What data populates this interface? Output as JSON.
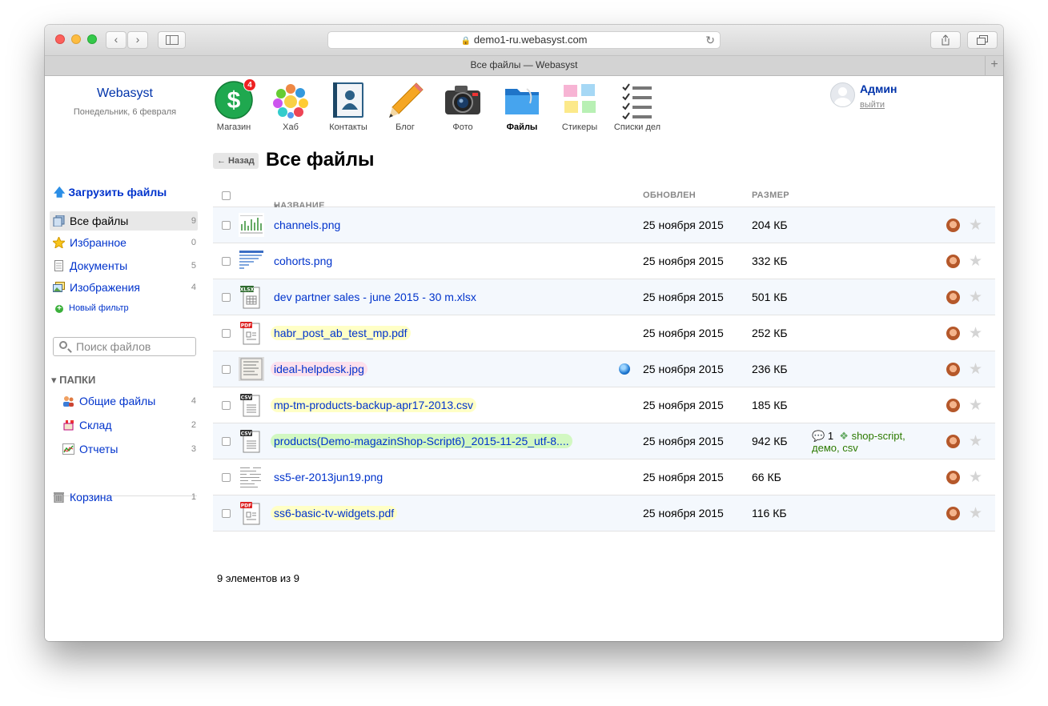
{
  "browser": {
    "url": "demo1-ru.webasyst.com",
    "tab_title": "Все файлы — Webasyst"
  },
  "sidebar": {
    "brand": "Webasyst",
    "date": "Понедельник, 6 февраля",
    "upload_label": "Загрузить файлы",
    "filters": [
      {
        "label": "Все файлы",
        "count": "9",
        "icon": "all-files-icon"
      },
      {
        "label": "Избранное",
        "count": "0",
        "icon": "star-icon"
      },
      {
        "label": "Документы",
        "count": "5",
        "icon": "document-icon"
      },
      {
        "label": "Изображения",
        "count": "4",
        "icon": "images-icon"
      }
    ],
    "new_filter": "Новый фильтр",
    "search_placeholder": "Поиск файлов",
    "folders_heading": "ПАПКИ",
    "folders": [
      {
        "label": "Общие файлы",
        "count": "4",
        "icon": "shared-folder-icon"
      },
      {
        "label": "Склад",
        "count": "2",
        "icon": "store-icon"
      },
      {
        "label": "Отчеты",
        "count": "3",
        "icon": "chart-icon"
      }
    ],
    "trash": {
      "label": "Корзина",
      "count": "1",
      "icon": "trash-icon"
    }
  },
  "apps": [
    {
      "label": "Магазин",
      "icon": "shop-icon",
      "badge": "4"
    },
    {
      "label": "Хаб",
      "icon": "hub-icon"
    },
    {
      "label": "Контакты",
      "icon": "contacts-icon"
    },
    {
      "label": "Блог",
      "icon": "pencil-icon"
    },
    {
      "label": "Фото",
      "icon": "camera-icon"
    },
    {
      "label": "Файлы",
      "icon": "folder-icon",
      "selected": true
    },
    {
      "label": "Стикеры",
      "icon": "stickers-icon"
    },
    {
      "label": "Списки дел",
      "icon": "todo-icon"
    }
  ],
  "user": {
    "name": "Админ",
    "logout": "выйти"
  },
  "page": {
    "back": "← Назад",
    "title": "Все файлы"
  },
  "table": {
    "columns": {
      "name": "НАЗВАНИЕ",
      "updated": "ОБНОВЛЕН",
      "size": "РАЗМЕР"
    },
    "rows": [
      {
        "name": "channels.png",
        "updated": "25 ноября 2015",
        "size": "204 КБ",
        "type": "image"
      },
      {
        "name": "cohorts.png",
        "updated": "25 ноября 2015",
        "size": "332 КБ",
        "type": "image"
      },
      {
        "name": "dev partner sales - june 2015 - 30 m.xlsx",
        "updated": "25 ноября 2015",
        "size": "501 КБ",
        "type": "xlsx"
      },
      {
        "name": "habr_post_ab_test_mp.pdf",
        "updated": "25 ноября 2015",
        "size": "252 КБ",
        "type": "pdf",
        "highlight": "yellow"
      },
      {
        "name": "ideal-helpdesk.jpg",
        "updated": "25 ноября 2015",
        "size": "236 КБ",
        "type": "image",
        "highlight": "pink",
        "shared": true
      },
      {
        "name": "mp-tm-products-backup-apr17-2013.csv",
        "updated": "25 ноября 2015",
        "size": "185 КБ",
        "type": "csv",
        "highlight": "yellow"
      },
      {
        "name": "products(Demo-magazinShop-Script6)_2015-11-25_utf-8....",
        "updated": "25 ноября 2015",
        "size": "942 КБ",
        "type": "csv",
        "highlight": "green",
        "comments": "1",
        "tags": [
          "shop-script",
          "демо",
          "csv"
        ]
      },
      {
        "name": "ss5-er-2013jun19.png",
        "updated": "25 ноября 2015",
        "size": "66 КБ",
        "type": "image"
      },
      {
        "name": "ss6-basic-tv-widgets.pdf",
        "updated": "25 ноября 2015",
        "size": "116 КБ",
        "type": "pdf",
        "highlight": "yellow"
      }
    ],
    "footer": "9 элементов из 9"
  }
}
